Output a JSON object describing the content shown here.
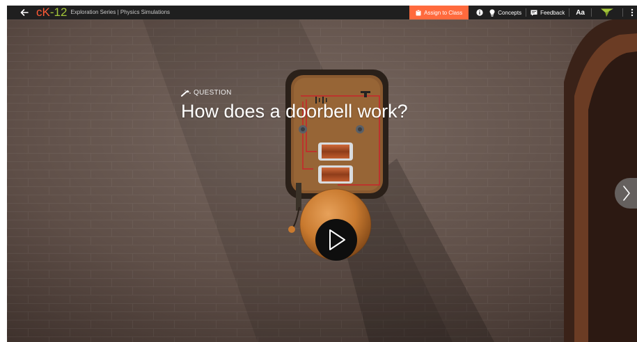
{
  "topbar": {
    "logo_c": "c",
    "logo_k": "K",
    "logo_dash": "-",
    "logo_num": "12",
    "series_title": "Exploration Series | Physics Simulations",
    "assign_label": "Assign to Class",
    "concepts_label": "Concepts",
    "feedback_label": "Feedback",
    "font_label": "Aa"
  },
  "question": {
    "label": "QUESTION",
    "title": "How does a doorbell work?"
  },
  "colors": {
    "accent_orange": "#ff6a3d",
    "logo_green": "#a4c639",
    "topbar_bg": "#1f1f1f"
  },
  "icons": [
    "back-arrow-icon",
    "clipboard-icon",
    "info-icon",
    "lightbulb-icon",
    "feedback-icon",
    "flag-icon",
    "more-vertical-icon",
    "magic-wand-icon",
    "play-icon",
    "chevron-right-icon"
  ]
}
